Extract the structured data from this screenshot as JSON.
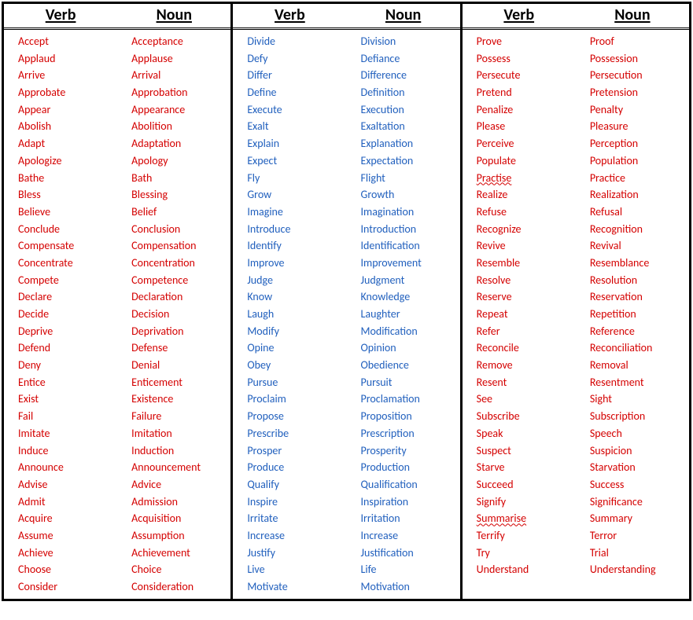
{
  "headers": {
    "verb": "Verb",
    "noun": "Noun"
  },
  "groups": [
    {
      "color": "red",
      "rows": [
        {
          "v": "Accept",
          "n": "Acceptance"
        },
        {
          "v": "Applaud",
          "n": "Applause"
        },
        {
          "v": "Arrive",
          "n": "Arrival"
        },
        {
          "v": "Approbate",
          "n": "Approbation"
        },
        {
          "v": "Appear",
          "n": "Appearance"
        },
        {
          "v": "Abolish",
          "n": "Abolition"
        },
        {
          "v": "Adapt",
          "n": "Adaptation"
        },
        {
          "v": "Apologize",
          "n": "Apology"
        },
        {
          "v": "Bathe",
          "n": "Bath"
        },
        {
          "v": "Bless",
          "n": "Blessing"
        },
        {
          "v": "Believe",
          "n": "Belief"
        },
        {
          "v": "Conclude",
          "n": "Conclusion"
        },
        {
          "v": "Compensate",
          "n": "Compensation"
        },
        {
          "v": "Concentrate",
          "n": "Concentration"
        },
        {
          "v": "Compete",
          "n": "Competence"
        },
        {
          "v": "Declare",
          "n": "Declaration"
        },
        {
          "v": "Decide",
          "n": "Decision"
        },
        {
          "v": "Deprive",
          "n": "Deprivation"
        },
        {
          "v": "Defend",
          "n": "Defense"
        },
        {
          "v": "Deny",
          "n": "Denial"
        },
        {
          "v": "Entice",
          "n": "Enticement"
        },
        {
          "v": "Exist",
          "n": "Existence"
        },
        {
          "v": "Fail",
          "n": "Failure"
        },
        {
          "v": "Imitate",
          "n": "Imitation"
        },
        {
          "v": "Induce",
          "n": "Induction"
        },
        {
          "v": "Announce",
          "n": "Announcement"
        },
        {
          "v": "Advise",
          "n": "Advice"
        },
        {
          "v": "Admit",
          "n": "Admission"
        },
        {
          "v": "Acquire",
          "n": "Acquisition"
        },
        {
          "v": "Assume",
          "n": "Assumption"
        },
        {
          "v": "Achieve",
          "n": "Achievement"
        },
        {
          "v": "Choose",
          "n": "Choice"
        },
        {
          "v": "Consider",
          "n": "Consideration"
        }
      ]
    },
    {
      "color": "blue",
      "rows": [
        {
          "v": "Divide",
          "n": "Division"
        },
        {
          "v": "Defy",
          "n": "Defiance"
        },
        {
          "v": "Differ",
          "n": "Difference"
        },
        {
          "v": "Define",
          "n": "Definition"
        },
        {
          "v": "Execute",
          "n": "Execution"
        },
        {
          "v": "Exalt",
          "n": "Exaltation"
        },
        {
          "v": "Explain",
          "n": "Explanation"
        },
        {
          "v": "Expect",
          "n": "Expectation"
        },
        {
          "v": "Fly",
          "n": "Flight"
        },
        {
          "v": "Grow",
          "n": "Growth"
        },
        {
          "v": "Imagine",
          "n": "Imagination"
        },
        {
          "v": "Introduce",
          "n": "Introduction"
        },
        {
          "v": "Identify",
          "n": "Identification"
        },
        {
          "v": "Improve",
          "n": "Improvement"
        },
        {
          "v": "Judge",
          "n": "Judgment"
        },
        {
          "v": "Know",
          "n": "Knowledge"
        },
        {
          "v": "Laugh",
          "n": "Laughter"
        },
        {
          "v": "Modify",
          "n": "Modification"
        },
        {
          "v": "Opine",
          "n": "Opinion"
        },
        {
          "v": "Obey",
          "n": "Obedience"
        },
        {
          "v": "Pursue",
          "n": "Pursuit"
        },
        {
          "v": "Proclaim",
          "n": "Proclamation"
        },
        {
          "v": "Propose",
          "n": "Proposition"
        },
        {
          "v": "Prescribe",
          "n": "Prescription"
        },
        {
          "v": "Prosper",
          "n": "Prosperity"
        },
        {
          "v": "Produce",
          "n": "Production"
        },
        {
          "v": "Qualify",
          "n": "Qualification"
        },
        {
          "v": "Inspire",
          "n": "Inspiration"
        },
        {
          "v": "Irritate",
          "n": "Irritation"
        },
        {
          "v": "Increase",
          "n": "Increase"
        },
        {
          "v": "Justify",
          "n": "Justification"
        },
        {
          "v": "Live",
          "n": "Life"
        },
        {
          "v": "Motivate",
          "n": "Motivation"
        }
      ]
    },
    {
      "color": "red",
      "rows": [
        {
          "v": "Prove",
          "n": "Proof"
        },
        {
          "v": "Possess",
          "n": "Possession"
        },
        {
          "v": "Persecute",
          "n": "Persecution"
        },
        {
          "v": "Pretend",
          "n": "Pretension"
        },
        {
          "v": "Penalize",
          "n": "Penalty"
        },
        {
          "v": "Please",
          "n": "Pleasure"
        },
        {
          "v": "Perceive",
          "n": "Perception"
        },
        {
          "v": "Populate",
          "n": "Population"
        },
        {
          "v": "Practise",
          "n": "Practice",
          "vSquig": true
        },
        {
          "v": "Realize",
          "n": "Realization"
        },
        {
          "v": "Refuse",
          "n": "Refusal"
        },
        {
          "v": "Recognize",
          "n": "Recognition"
        },
        {
          "v": "Revive",
          "n": "Revival"
        },
        {
          "v": "Resemble",
          "n": "Resemblance"
        },
        {
          "v": "Resolve",
          "n": "Resolution"
        },
        {
          "v": "Reserve",
          "n": "Reservation"
        },
        {
          "v": "Repeat",
          "n": "Repetition"
        },
        {
          "v": "Refer",
          "n": "Reference"
        },
        {
          "v": "Reconcile",
          "n": "Reconciliation"
        },
        {
          "v": "Remove",
          "n": "Removal"
        },
        {
          "v": "Resent",
          "n": "Resentment"
        },
        {
          "v": "See",
          "n": "Sight"
        },
        {
          "v": "Subscribe",
          "n": "Subscription"
        },
        {
          "v": "Speak",
          "n": "Speech"
        },
        {
          "v": "Suspect",
          "n": "Suspicion"
        },
        {
          "v": "Starve",
          "n": "Starvation"
        },
        {
          "v": "Succeed",
          "n": "Success"
        },
        {
          "v": "Signify",
          "n": "Significance"
        },
        {
          "v": "Summarise",
          "n": "Summary",
          "vSquig": true
        },
        {
          "v": "Terrify",
          "n": "Terror"
        },
        {
          "v": "Try",
          "n": "Trial"
        },
        {
          "v": "Understand",
          "n": "Understanding"
        }
      ]
    }
  ]
}
